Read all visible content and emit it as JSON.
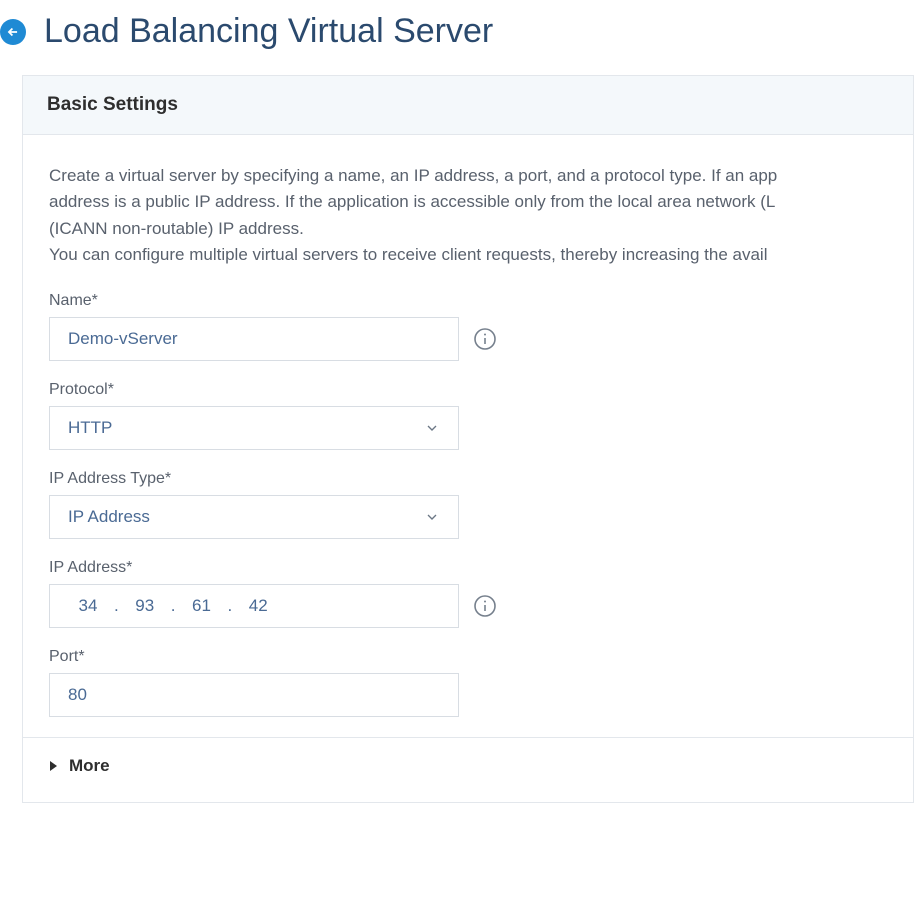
{
  "header": {
    "title": "Load Balancing Virtual Server"
  },
  "panel": {
    "title": "Basic Settings",
    "description_line1": "Create a virtual server by specifying a name, an IP address, a port, and a protocol type. If an app",
    "description_line2": "address is a public IP address. If the application is accessible only from the local area network (L",
    "description_line3": "(ICANN non-routable) IP address.",
    "description_line4": "You can configure multiple virtual servers to receive client requests, thereby increasing the avail",
    "fields": {
      "name": {
        "label": "Name*",
        "value": "Demo-vServer"
      },
      "protocol": {
        "label": "Protocol*",
        "value": "HTTP"
      },
      "ip_type": {
        "label": "IP Address Type*",
        "value": "IP Address"
      },
      "ip_address": {
        "label": "IP Address*",
        "oct1": "34",
        "oct2": "93",
        "oct3": "61",
        "oct4": "42"
      },
      "port": {
        "label": "Port*",
        "value": "80"
      }
    },
    "more_label": "More"
  }
}
